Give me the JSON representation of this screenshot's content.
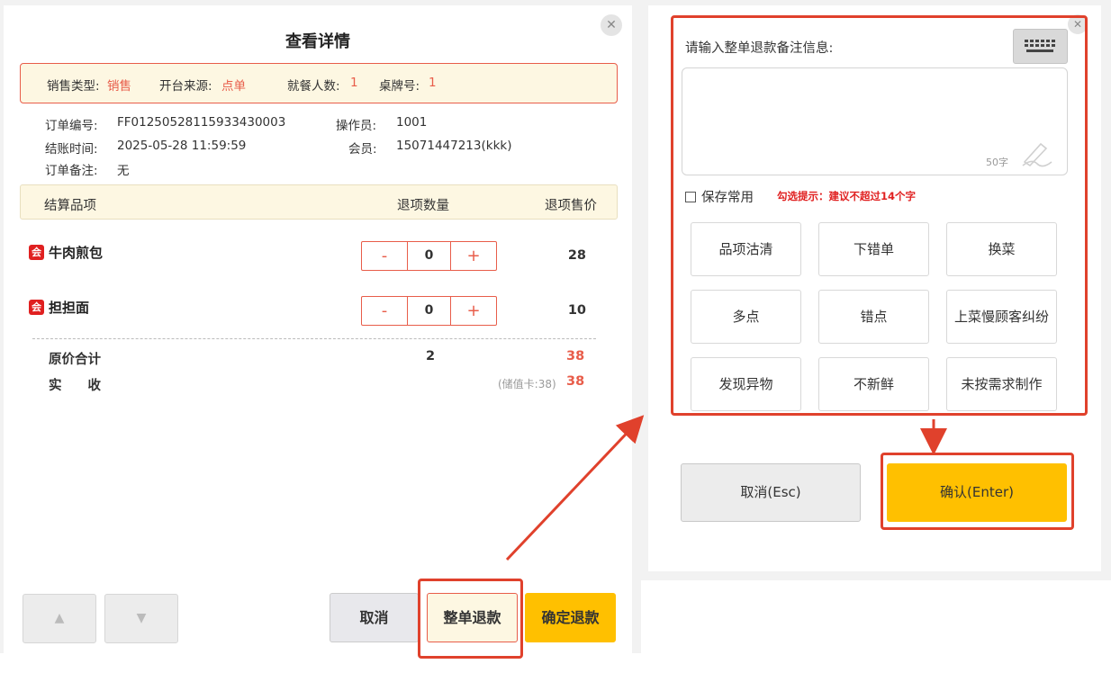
{
  "left_panel": {
    "title": "查看详情",
    "close_symbol": "✕",
    "info": {
      "sale_type_label": "销售类型:",
      "sale_type_value": "销售",
      "source_label": "开台来源:",
      "source_value": "点单",
      "guests_label": "就餐人数:",
      "guests_value": "1",
      "table_label": "桌牌号:",
      "table_value": "1"
    },
    "meta": {
      "order_no_label": "订单编号:",
      "order_no_value": "FF01250528115933430003",
      "operator_label": "操作员:",
      "operator_value": "1001",
      "checkout_time_label": "结账时间:",
      "checkout_time_value": "2025-05-28 11:59:59",
      "member_label": "会员:",
      "member_value": "15071447213(kkk)",
      "remark_label": "订单备注:",
      "remark_value": "无"
    },
    "table_header": {
      "item": "结算品项",
      "qty": "退项数量",
      "price": "退项售价"
    },
    "items": [
      {
        "badge": "会",
        "name": "牛肉煎包",
        "minus": "-",
        "qty": "0",
        "plus": "+",
        "price": "28"
      },
      {
        "badge": "会",
        "name": "担担面",
        "minus": "-",
        "qty": "0",
        "plus": "+",
        "price": "10"
      }
    ],
    "summary": {
      "original_total_label": "原价合计",
      "original_total_qty": "2",
      "original_total_value": "38",
      "received_label": "实　　收",
      "received_note": "(储值卡:38)",
      "received_value": "38"
    },
    "buttons": {
      "up": "▲",
      "down": "▼",
      "cancel": "取消",
      "refund_all": "整单退款",
      "confirm_refund": "确定退款"
    }
  },
  "right_panel": {
    "close_symbol": "✕",
    "prompt": "请输入整单退款备注信息:",
    "textarea_value": "",
    "char_limit": "50字",
    "save_common_label": "保存常用",
    "save_common_checked": false,
    "hint": "勾选提示：建议不超过14个字",
    "reasons": [
      "品项沽清",
      "下错单",
      "换菜",
      "多点",
      "错点",
      "上菜慢顾客纠纷",
      "发现异物",
      "不新鲜",
      "未按需求制作"
    ],
    "cancel_button": "取消(Esc)",
    "confirm_button": "确认(Enter)"
  },
  "colors": {
    "accent_red": "#e85d4a",
    "primary_yellow": "#ffc000",
    "highlight_bg": "#fdf7e2",
    "annotation_red": "#e0412c"
  }
}
